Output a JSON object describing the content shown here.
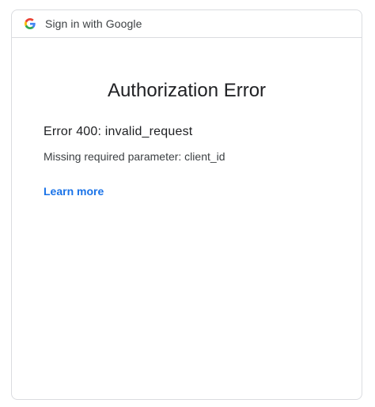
{
  "header": {
    "logo_icon": "google-g-logo",
    "text": "Sign in with Google"
  },
  "main": {
    "title": "Authorization Error",
    "error_code": "Error 400: invalid_request",
    "error_message": "Missing required parameter: client_id",
    "learn_more_label": "Learn more"
  },
  "colors": {
    "link": "#1a73e8",
    "border": "#dadce0",
    "text": "#202124"
  }
}
